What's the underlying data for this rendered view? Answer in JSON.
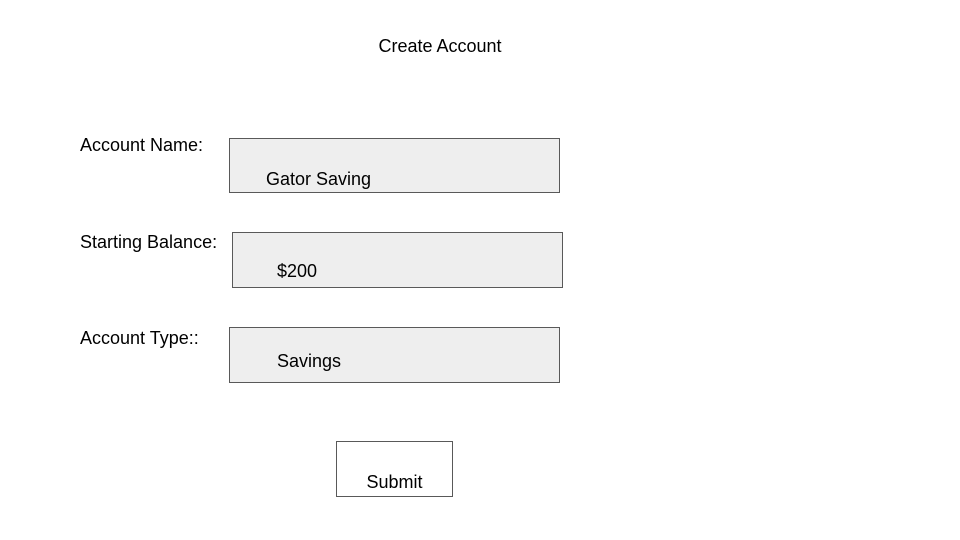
{
  "page": {
    "title": "Create Account"
  },
  "form": {
    "account_name": {
      "label": "Account Name:",
      "value": "Gator Saving"
    },
    "starting_balance": {
      "label": "Starting Balance:",
      "value": "$200"
    },
    "account_type": {
      "label": "Account Type::",
      "value": "Savings"
    },
    "submit_label": "Submit"
  },
  "colors": {
    "field_background": "#eeeeee",
    "field_border": "#595959",
    "text": "#000000",
    "page_background": "#ffffff"
  }
}
